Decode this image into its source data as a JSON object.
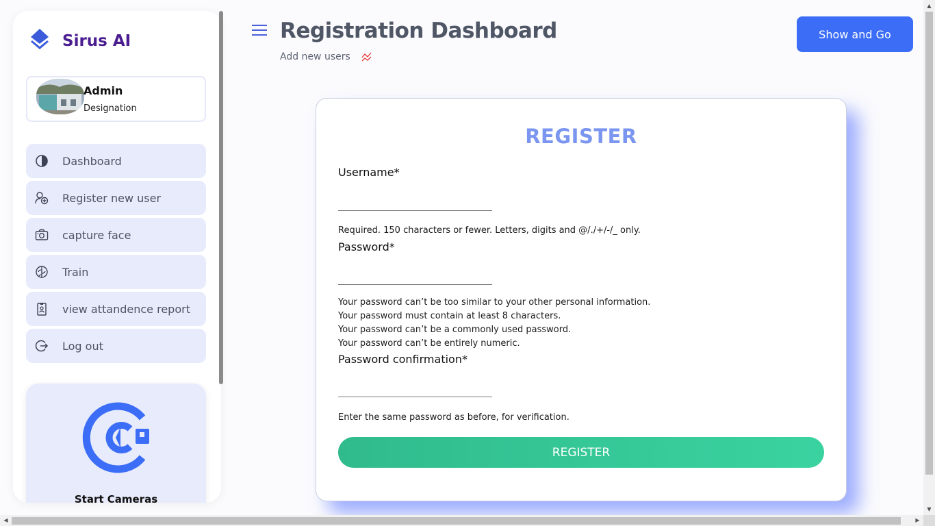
{
  "sidebar": {
    "brand": "Sirus AI",
    "profile": {
      "name": "Admin",
      "role": "Designation"
    },
    "items": [
      {
        "label": "Dashboard",
        "icon": "dashboard-icon"
      },
      {
        "label": "Register new user",
        "icon": "add-user-icon"
      },
      {
        "label": "capture face",
        "icon": "camera-icon"
      },
      {
        "label": "Train",
        "icon": "brain-icon"
      },
      {
        "label": "view attandence report",
        "icon": "report-icon"
      },
      {
        "label": "Log out",
        "icon": "logout-icon"
      }
    ],
    "camera_card": {
      "label": "Start Cameras",
      "icon": "start-camera-icon"
    }
  },
  "header": {
    "title": "Registration Dashboard",
    "subtitle": "Add new users",
    "action_button": "Show and Go"
  },
  "form": {
    "title": "REGISTER",
    "username": {
      "label": "Username*",
      "value": "",
      "help": "Required. 150 characters or fewer. Letters, digits and @/./+/-/_ only."
    },
    "password": {
      "label": "Password*",
      "value": "",
      "help": [
        "Your password can’t be too similar to your other personal information.",
        "Your password must contain at least 8 characters.",
        "Your password can’t be a commonly used password.",
        "Your password can’t be entirely numeric."
      ]
    },
    "password_confirmation": {
      "label": "Password confirmation*",
      "value": "",
      "help": "Enter the same password as before, for verification."
    },
    "submit_label": "REGISTER"
  },
  "colors": {
    "brand": "#4b1d91",
    "accent_blue": "#3b6df7",
    "title_blue": "#7b96f0",
    "nav_bg": "#e8ebfb",
    "submit_green": "#34c796"
  }
}
